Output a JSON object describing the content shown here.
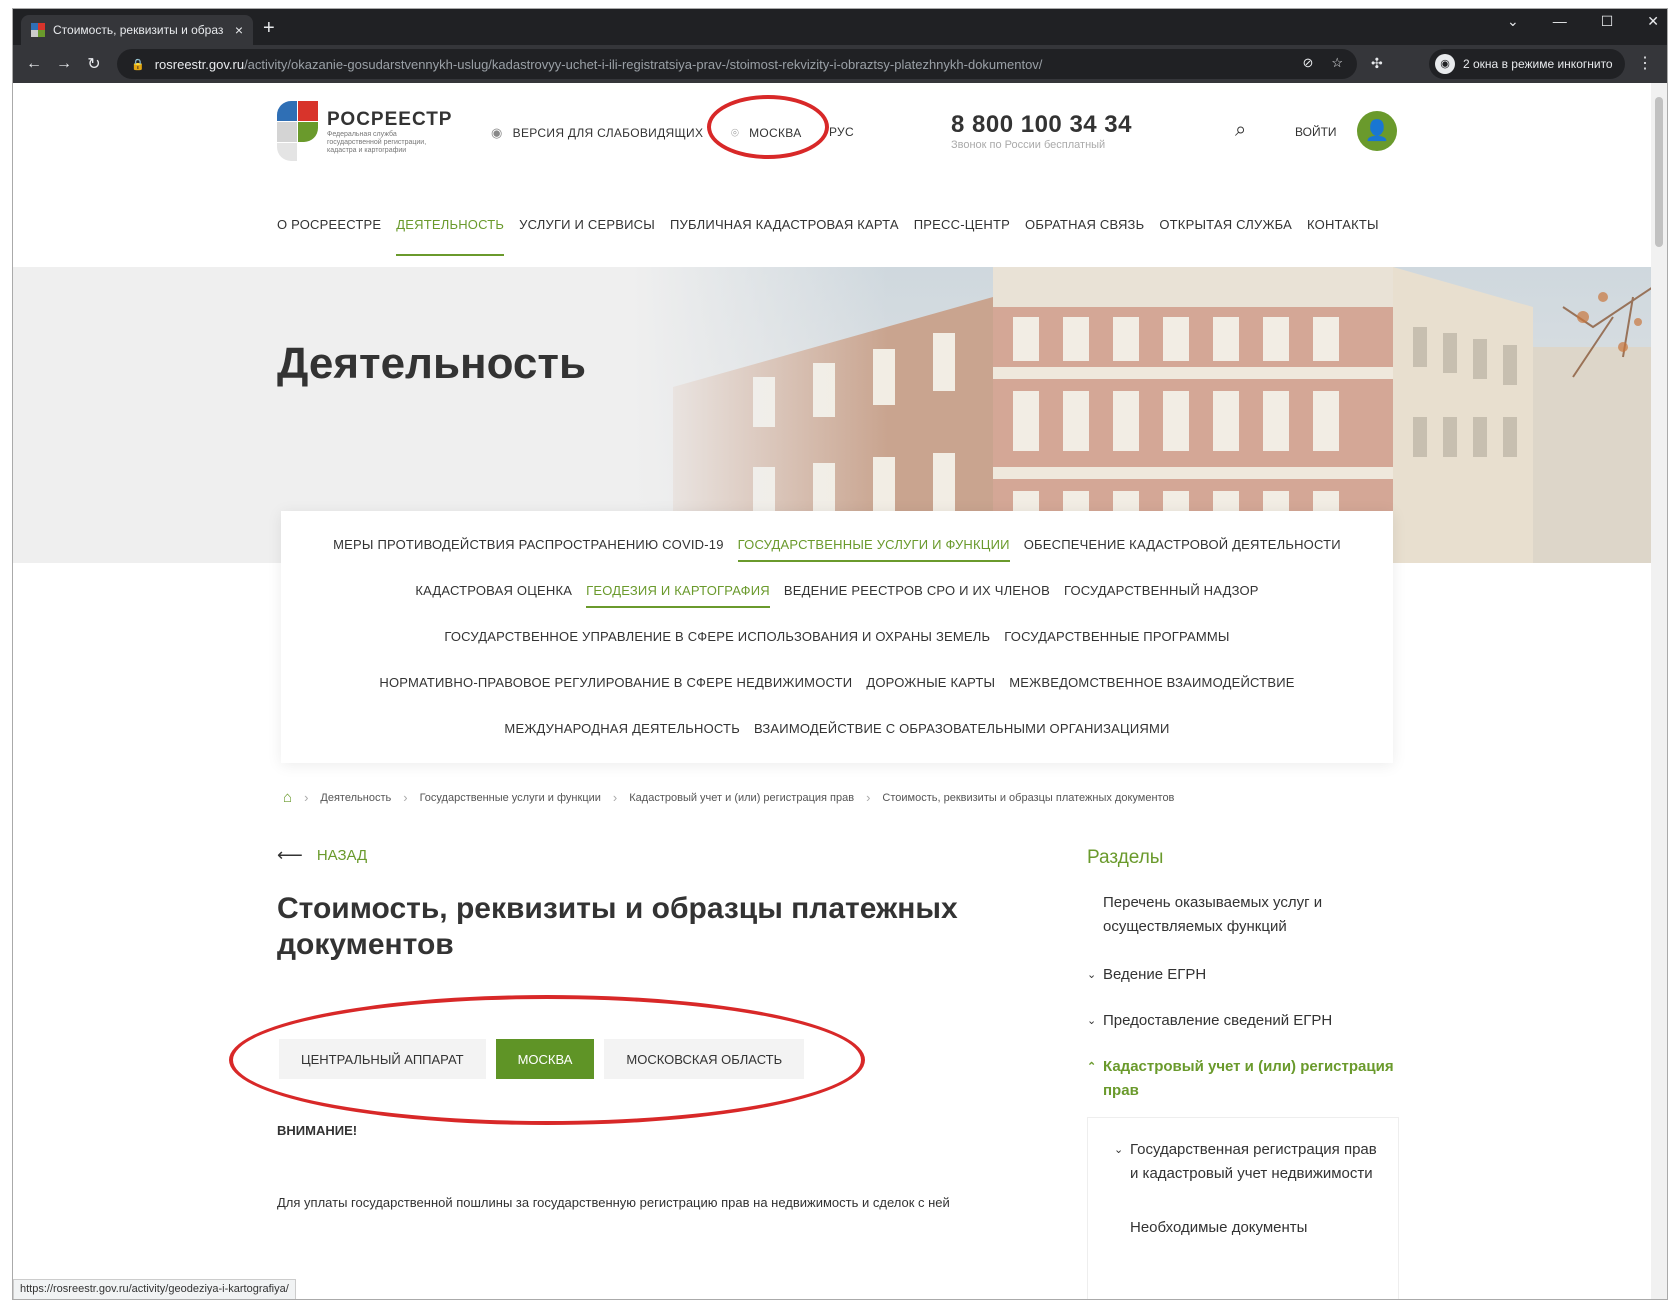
{
  "browser": {
    "tab_title": "Стоимость, реквизиты и образ",
    "tab_close": "×",
    "new_tab": "+",
    "url_host": "rosreestr.gov.ru",
    "url_path": "/activity/okazanie-gosudarstvennykh-uslug/kadastrovyy-uchet-i-ili-registratsiya-prav-/stoimost-rekvizity-i-obraztsy-platezhnykh-dokumentov/",
    "incognito_label": "2 окна в режиме инкогнито",
    "status_url": "https://rosreestr.gov.ru/activity/geodeziya-i-kartografiya/"
  },
  "header": {
    "logo_name": "РОСРЕЕСТР",
    "logo_sub": "Федеральная служба государственной регистрации, кадастра и картографии",
    "low_vision": "ВЕРСИЯ ДЛЯ СЛАБОВИДЯЩИХ",
    "region": "МОСКВА",
    "lang": "РУС",
    "phone": "8 800 100 34 34",
    "phone_caption": "Звонок по России бесплатный",
    "login": "ВОЙТИ"
  },
  "main_nav": [
    {
      "label": "О РОСРЕЕСТРЕ"
    },
    {
      "label": "ДЕЯТЕЛЬНОСТЬ",
      "active": true
    },
    {
      "label": "УСЛУГИ И СЕРВИСЫ"
    },
    {
      "label": "ПУБЛИЧНАЯ КАДАСТРОВАЯ КАРТА"
    },
    {
      "label": "ПРЕСС-ЦЕНТР"
    },
    {
      "label": "ОБРАТНАЯ СВЯЗЬ"
    },
    {
      "label": "ОТКРЫТАЯ СЛУЖБА"
    },
    {
      "label": "КОНТАКТЫ"
    }
  ],
  "hero": {
    "title": "Деятельность"
  },
  "submenu": {
    "row1": [
      "МЕРЫ ПРОТИВОДЕЙСТВИЯ РАСПРОСТРАНЕНИЮ COVID-19",
      "ГОСУДАРСТВЕННЫЕ УСЛУГИ И ФУНКЦИИ",
      "ОБЕСПЕЧЕНИЕ КАДАСТРОВОЙ ДЕЯТЕЛЬНОСТИ"
    ],
    "row2": [
      "КАДАСТРОВАЯ ОЦЕНКА",
      "ГЕОДЕЗИЯ И КАРТОГРАФИЯ",
      "ВЕДЕНИЕ РЕЕСТРОВ СРО И ИХ ЧЛЕНОВ",
      "ГОСУДАРСТВЕННЫЙ НАДЗОР"
    ],
    "row3": [
      "ГОСУДАРСТВЕННОЕ УПРАВЛЕНИЕ В СФЕРЕ ИСПОЛЬЗОВАНИЯ И ОХРАНЫ ЗЕМЕЛЬ",
      "ГОСУДАРСТВЕННЫЕ ПРОГРАММЫ"
    ],
    "row4": [
      "НОРМАТИВНО-ПРАВОВОЕ РЕГУЛИРОВАНИЕ В СФЕРЕ НЕДВИЖИМОСТИ",
      "ДОРОЖНЫЕ КАРТЫ",
      "МЕЖВЕДОМСТВЕННОЕ ВЗАИМОДЕЙСТВИЕ"
    ],
    "row5": [
      "МЕЖДУНАРОДНАЯ ДЕЯТЕЛЬНОСТЬ",
      "ВЗАИМОДЕЙСТВИЕ С ОБРАЗОВАТЕЛЬНЫМИ ОРГАНИЗАЦИЯМИ"
    ]
  },
  "breadcrumb": [
    "Деятельность",
    "Государственные услуги и функции",
    "Кадастровый учет и (или) регистрация прав",
    "Стоимость, реквизиты и образцы платежных документов"
  ],
  "content": {
    "back": "НАЗАД",
    "title": "Стоимость, реквизиты и образцы платежных документов",
    "segments": [
      "ЦЕНТРАЛЬНЫЙ АППАРАТ",
      "МОСКВА",
      "МОСКОВСКАЯ ОБЛАСТЬ"
    ],
    "attention": "ВНИМАНИЕ!",
    "paragraph": "Для уплаты государственной пошлины за государственную регистрацию прав на недвижимость и сделок с ней"
  },
  "sidebar": {
    "heading": "Разделы",
    "item1": "Перечень оказываемых услуг и осуществляемых функций",
    "item2": "Ведение ЕГРН",
    "item3": "Предоставление сведений ЕГРН",
    "item4": "Кадастровый учет и (или) регистрация прав",
    "sub1": "Государственная регистрация прав и кадастровый учет недвижимости",
    "sub2": "Необходимые документы"
  },
  "colors": {
    "brand_green": "#6a9a2c",
    "annotation_red": "#d82828"
  }
}
